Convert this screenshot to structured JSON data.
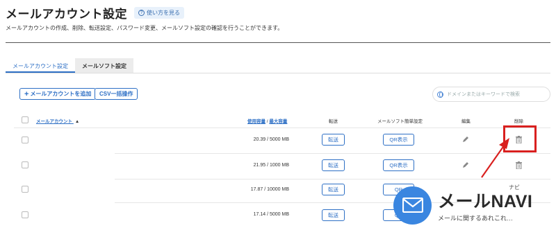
{
  "header": {
    "title": "メールアカウント設定",
    "help_label": "使い方を見る",
    "help_icon": "question-circle-icon"
  },
  "description": "メールアカウントの作成、削除、転送設定、パスワード変更、メールソフト設定の確認を行うことができます。",
  "tabs": [
    {
      "label": "メールアカウント設定",
      "active": true
    },
    {
      "label": "メールソフト設定",
      "active": false
    }
  ],
  "toolbar": {
    "add_label": "メールアカウントを追加",
    "csv_label": "CSV一括操作",
    "search_placeholder": "ドメインまたはキーワードで検索",
    "search_icon": "globe-icon"
  },
  "table": {
    "columns": {
      "account": "メールアカウント",
      "sort_indicator": "▲",
      "usage_used": "使用容量",
      "usage_sep": " / ",
      "usage_max": "最大容量",
      "transfer": "転送",
      "mail_setting": "メールソフト簡単設定",
      "edit": "編集",
      "delete": "削除"
    },
    "rows": [
      {
        "usage": "20.39 / 5000 MB",
        "transfer": "転送",
        "qr": "QR表示"
      },
      {
        "usage": "21.95 / 1000 MB",
        "transfer": "転送",
        "qr": "QR表示"
      },
      {
        "usage": "17.87 / 10000 MB",
        "transfer": "転送",
        "qr": "QR"
      },
      {
        "usage": "17.14 / 5000 MB",
        "transfer": "転送",
        "qr": "QR"
      }
    ]
  },
  "annotation": {
    "highlight_color": "#d9201f"
  },
  "watermark": {
    "name": "メールNAVI",
    "ruby": "ナビ",
    "tagline": "メールに関するあれこれ…"
  },
  "colors": {
    "accent": "#2d6fc5",
    "logo_blue": "#3a86e0"
  }
}
